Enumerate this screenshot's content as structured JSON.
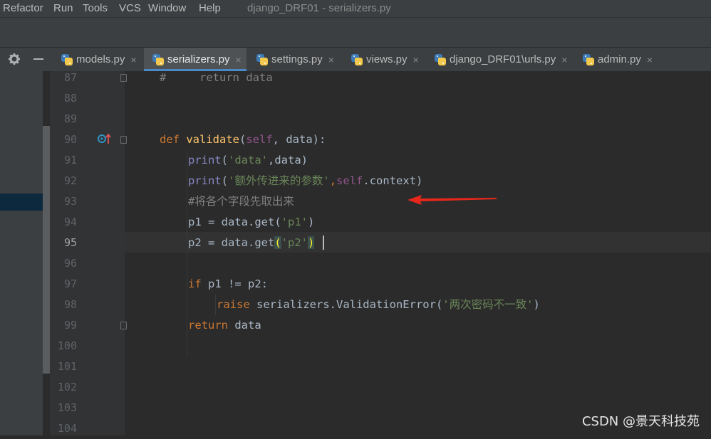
{
  "menubar": {
    "items": [
      "Refactor",
      "Run",
      "Tools",
      "VCS",
      "Window",
      "Help"
    ],
    "title": "django_DRF01 - serializers.py"
  },
  "tabs": [
    {
      "label": "models.py",
      "active": false
    },
    {
      "label": "serializers.py",
      "active": true
    },
    {
      "label": "settings.py",
      "active": false
    },
    {
      "label": "views.py",
      "active": false
    },
    {
      "label": "django_DRF01\\urls.py",
      "active": false
    },
    {
      "label": "admin.py",
      "active": false
    }
  ],
  "tab_close_glyph": "×",
  "toolwindow": {
    "settings_icon": "gear-icon",
    "hide_icon": "minimize-icon"
  },
  "editor": {
    "current_line": 95,
    "line_numbers": [
      "87",
      "88",
      "89",
      "90",
      "91",
      "92",
      "93",
      "94",
      "95",
      "96",
      "97",
      "98",
      "99",
      "100",
      "101",
      "102",
      "103",
      "104"
    ],
    "lines": {
      "l87": {
        "hash": "#",
        "text": "     return data"
      },
      "l90": {
        "def": "def",
        "name": "validate",
        "open": "(",
        "self": "self",
        "rest": ", data):"
      },
      "l91": {
        "print": "print",
        "open": "(",
        "str": "'data'",
        "rest": ",data)"
      },
      "l92": {
        "print": "print",
        "open": "(",
        "str": "'额外传进来的参数'",
        "comma": ",",
        "self": "self",
        "rest": ".context)"
      },
      "l93": {
        "comment": "#将各个字段先取出来"
      },
      "l94": {
        "pre": "p1 = data.get(",
        "str": "'p1'",
        "post": ")"
      },
      "l95": {
        "pre": "p2 = data.get",
        "open": "(",
        "str": "'p2'",
        "close": ")"
      },
      "l97": {
        "kw": "if",
        "rest": " p1 != p2:"
      },
      "l98": {
        "kw": "raise",
        "rest": " serializers.ValidationError(",
        "str": "'两次密码不一致'",
        "close": ")"
      },
      "l99": {
        "kw": "return",
        "rest": " data"
      }
    }
  },
  "colors": {
    "annotation_arrow": "#e8271c",
    "keyword": "#cc7832",
    "function": "#ffc66d",
    "string": "#6a8759",
    "self": "#94558d",
    "comment": "#808080",
    "builtin": "#8888c6"
  },
  "watermark": "CSDN @景天科技苑"
}
